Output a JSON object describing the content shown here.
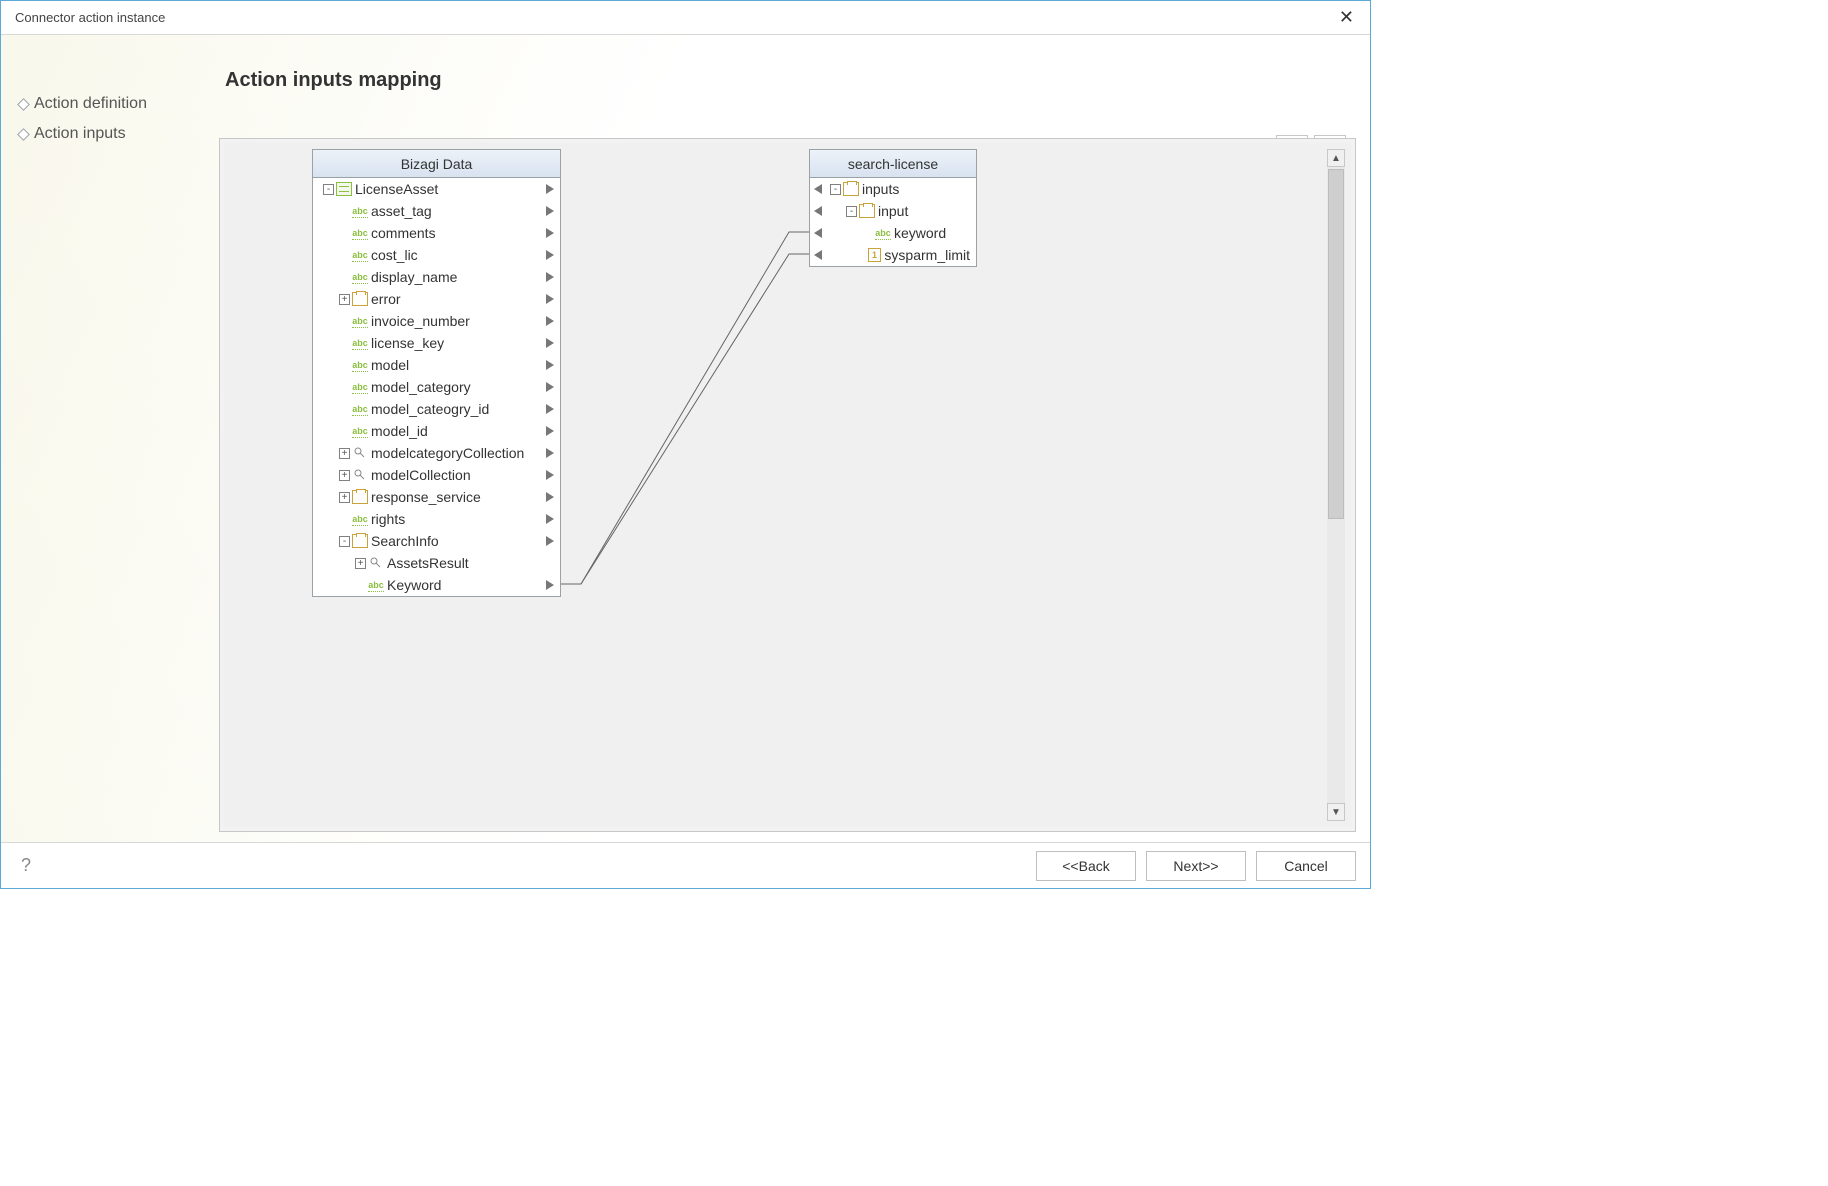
{
  "window": {
    "title": "Connector action instance"
  },
  "sidebar": {
    "items": [
      {
        "label": "Action definition"
      },
      {
        "label": "Action inputs"
      }
    ]
  },
  "main": {
    "heading": "Action inputs mapping"
  },
  "toolbar": {
    "map_button": "auto-map",
    "fit_button": "fit-view"
  },
  "left_panel": {
    "title": "Bizagi Data",
    "nodes": [
      {
        "indent": 0,
        "exp": "-",
        "icon": "entity",
        "label": "LicenseAsset",
        "tri": true
      },
      {
        "indent": 1,
        "exp": "",
        "icon": "abc",
        "label": "asset_tag",
        "tri": true
      },
      {
        "indent": 1,
        "exp": "",
        "icon": "abc",
        "label": "comments",
        "tri": true
      },
      {
        "indent": 1,
        "exp": "",
        "icon": "abc",
        "label": "cost_lic",
        "tri": true
      },
      {
        "indent": 1,
        "exp": "",
        "icon": "abc",
        "label": "display_name",
        "tri": true
      },
      {
        "indent": 1,
        "exp": "+",
        "icon": "obj",
        "label": "error",
        "tri": true
      },
      {
        "indent": 1,
        "exp": "",
        "icon": "abc",
        "label": "invoice_number",
        "tri": true
      },
      {
        "indent": 1,
        "exp": "",
        "icon": "abc",
        "label": "license_key",
        "tri": true
      },
      {
        "indent": 1,
        "exp": "",
        "icon": "abc",
        "label": "model",
        "tri": true
      },
      {
        "indent": 1,
        "exp": "",
        "icon": "abc",
        "label": "model_category",
        "tri": true
      },
      {
        "indent": 1,
        "exp": "",
        "icon": "abc",
        "label": "model_cateogry_id",
        "tri": true
      },
      {
        "indent": 1,
        "exp": "",
        "icon": "abc",
        "label": "model_id",
        "tri": true
      },
      {
        "indent": 1,
        "exp": "+",
        "icon": "coll",
        "label": "modelcategoryCollection",
        "tri": true
      },
      {
        "indent": 1,
        "exp": "+",
        "icon": "coll",
        "label": "modelCollection",
        "tri": true
      },
      {
        "indent": 1,
        "exp": "+",
        "icon": "obj",
        "label": "response_service",
        "tri": true
      },
      {
        "indent": 1,
        "exp": "",
        "icon": "abc",
        "label": "rights",
        "tri": true
      },
      {
        "indent": 1,
        "exp": "-",
        "icon": "obj",
        "label": "SearchInfo",
        "tri": true
      },
      {
        "indent": 2,
        "exp": "+",
        "icon": "coll",
        "label": "AssetsResult",
        "tri": false
      },
      {
        "indent": 2,
        "exp": "",
        "icon": "abc",
        "label": "Keyword",
        "tri": true
      }
    ]
  },
  "right_panel": {
    "title": "search-license",
    "nodes": [
      {
        "indent": 0,
        "exp": "-",
        "icon": "obj",
        "label": "inputs",
        "tri": true
      },
      {
        "indent": 1,
        "exp": "-",
        "icon": "obj",
        "label": "input",
        "tri": true
      },
      {
        "indent": 2,
        "exp": "",
        "icon": "abc",
        "label": "keyword",
        "tri": true
      },
      {
        "indent": 2,
        "exp": "",
        "icon": "num",
        "label": "sysparm_limit",
        "tri": true
      }
    ]
  },
  "links": [
    {
      "from_left_row": 18,
      "to_right_row": 2
    },
    {
      "from_left_row": 18,
      "to_right_row": 3
    }
  ],
  "footer": {
    "back": "<<Back",
    "next": "Next>>",
    "cancel": "Cancel"
  }
}
